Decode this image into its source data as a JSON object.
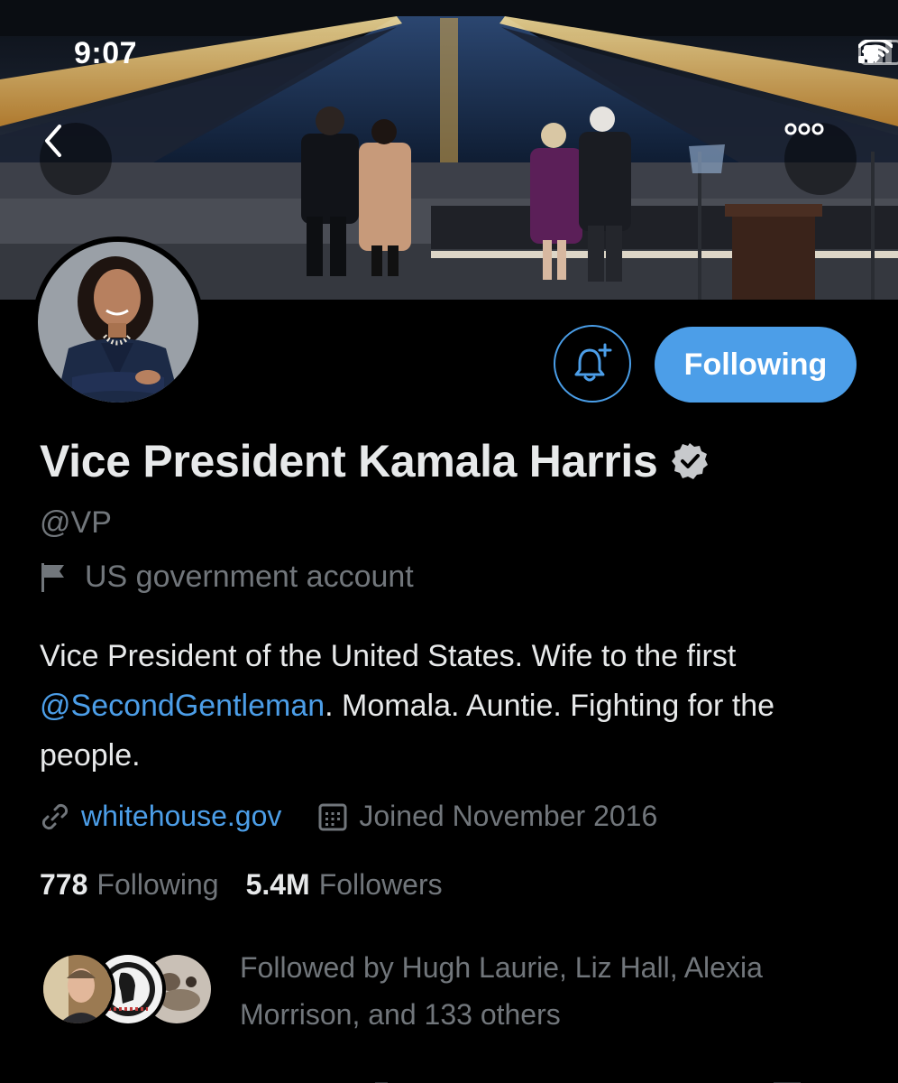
{
  "status_bar": {
    "time": "9:07"
  },
  "header": {
    "back_icon": "chevron-left-icon",
    "more_icon": "more-horizontal-icon"
  },
  "actions": {
    "notify_icon": "bell-plus-icon",
    "following_label": "Following"
  },
  "profile": {
    "display_name": "Vice President Kamala Harris",
    "verified_icon": "verified-badge-icon",
    "handle": "@VP",
    "label_icon": "flag-icon",
    "label": "US government account",
    "bio": {
      "part1": "Vice President of the United States. Wife to the first ",
      "mention": "@SecondGentleman",
      "part2": ". Momala. Auntie. Fighting for the people."
    },
    "website_icon": "link-icon",
    "website": "whitehouse.gov",
    "joined_icon": "calendar-icon",
    "joined": "Joined November 2016"
  },
  "stats": {
    "following_count": "778",
    "following_label": "Following",
    "followers_count": "5.4M",
    "followers_label": "Followers"
  },
  "followed_by": {
    "text": "Followed by Hugh Laurie, Liz Hall, Alexia Morrison, and 133 others"
  },
  "colors": {
    "accent": "#4c9ee8",
    "background": "#000000",
    "secondary_text": "#71767b",
    "primary_text": "#e7e9ea"
  }
}
